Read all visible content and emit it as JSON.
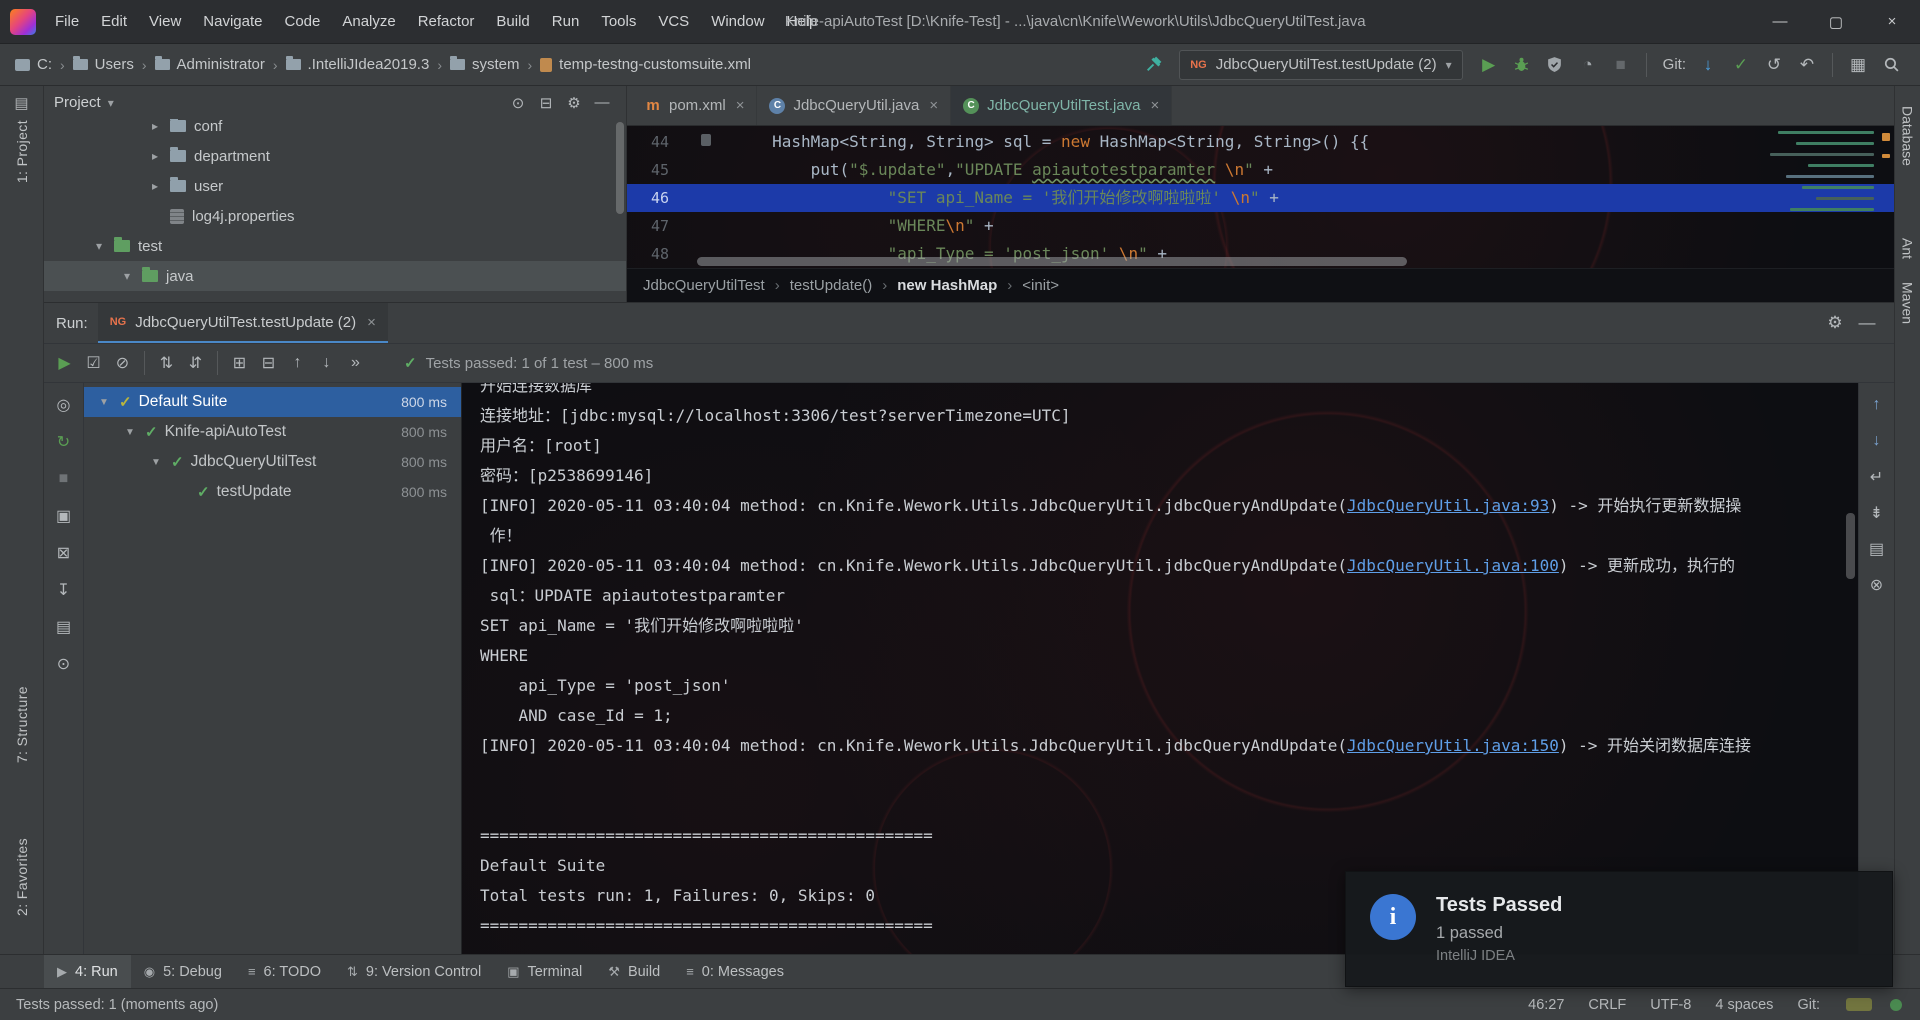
{
  "glyphs": {
    "crumb_sep": "›",
    "expanded": "▾",
    "collapsed": "▸",
    "tree_expanded": "▼",
    "close": "×",
    "check": "✓",
    "caret": "▾"
  },
  "title_bar": {
    "menus": [
      "File",
      "Edit",
      "View",
      "Navigate",
      "Code",
      "Analyze",
      "Refactor",
      "Build",
      "Run",
      "Tools",
      "VCS",
      "Window",
      "Help"
    ],
    "title": "Knife-apiAutoTest [D:\\Knife-Test] - ...\\java\\cn\\Knife\\Wework\\Utils\\JdbcQueryUtilTest.java",
    "window_buttons": [
      {
        "name": "minimize-button",
        "glyph": "—"
      },
      {
        "name": "maximize-button",
        "glyph": "▢"
      },
      {
        "name": "close-button",
        "glyph": "×"
      }
    ]
  },
  "navbar": {
    "breadcrumbs": [
      {
        "label": "C:",
        "icon": "drive"
      },
      {
        "label": "Users",
        "icon": "folder"
      },
      {
        "label": "Administrator",
        "icon": "folder"
      },
      {
        "label": ".IntelliJIdea2019.3",
        "icon": "folder"
      },
      {
        "label": "system",
        "icon": "folder"
      },
      {
        "label": "temp-testng-customsuite.xml",
        "icon": "xml-file"
      }
    ],
    "run_config": {
      "label": "JdbcQueryUtilTest.testUpdate (2)",
      "icon_text": "NG"
    },
    "run_actions": [
      {
        "name": "run-button",
        "g": "▶",
        "color": "#5a9e53"
      },
      {
        "name": "debug-button",
        "svg": "bug",
        "color": "#5a9e53"
      },
      {
        "name": "coverage-button",
        "svg": "shield",
        "color": "#a0a6aa"
      },
      {
        "name": "profiler-button",
        "g": "◔",
        "color": "#a0a6aa"
      },
      {
        "name": "stop-button",
        "g": "■",
        "color": "#64686b"
      }
    ],
    "git_label": "Git:",
    "git_actions": [
      {
        "name": "git-update-button",
        "g": "↓",
        "color": "#4b9edd"
      },
      {
        "name": "git-commit-button",
        "g": "✓",
        "color": "#5a9e53"
      },
      {
        "name": "git-history-button",
        "g": "↺"
      },
      {
        "name": "git-rollback-button",
        "g": "↶"
      }
    ],
    "right_actions": [
      {
        "name": "toolwindow-layout-button",
        "g": "▦"
      },
      {
        "name": "search-everywhere-button",
        "svg": "search"
      }
    ]
  },
  "activity_bars": {
    "left_top": "1: Project",
    "left_middle": "7: Structure",
    "left_bottom": "2: Favorites",
    "right": [
      "Database",
      "Ant",
      "Maven"
    ]
  },
  "project": {
    "header": "Project",
    "caret": "▾",
    "header_icons": [
      {
        "name": "select-opened-file-icon",
        "g": "⊙"
      },
      {
        "name": "collapse-all-icon",
        "g": "⊟"
      },
      {
        "name": "project-options-icon",
        "g": "⚙"
      },
      {
        "name": "hide-project-panel-icon",
        "g": "—"
      }
    ],
    "items": [
      {
        "label": "conf",
        "icon": "folder",
        "indent": 4,
        "arrow": true,
        "expanded": false
      },
      {
        "label": "department",
        "icon": "folder",
        "indent": 4,
        "arrow": true,
        "expanded": false
      },
      {
        "label": "user",
        "icon": "folder",
        "indent": 4,
        "arrow": true,
        "expanded": false
      },
      {
        "label": "log4j.properties",
        "icon": "props",
        "indent": 4,
        "arrow": false
      },
      {
        "label": "test",
        "icon": "folder-test",
        "indent": 2,
        "arrow": true,
        "expanded": true
      },
      {
        "label": "java",
        "icon": "folder-source",
        "indent": 3,
        "arrow": true,
        "expanded": true,
        "selected": true
      }
    ]
  },
  "editor": {
    "tabs": [
      {
        "label": "pom.xml",
        "icon": "maven",
        "icon_text": "m",
        "active": false
      },
      {
        "label": "JdbcQueryUtil.java",
        "icon": "class",
        "icon_text": "C",
        "active": false
      },
      {
        "label": "JdbcQueryUtilTest.java",
        "icon": "test",
        "icon_text": "C",
        "active": true
      }
    ],
    "lines": [
      {
        "num": "44",
        "segs": [
          {
            "c": "p",
            "t": "        HashMap<String, String> sql = "
          },
          {
            "c": "kw",
            "t": "new "
          },
          {
            "c": "p",
            "t": "HashMap<String, String>() {{"
          }
        ]
      },
      {
        "num": "45",
        "segs": [
          {
            "c": "p",
            "t": "            put("
          },
          {
            "c": "str",
            "t": "\"$.update\""
          },
          {
            "c": "p",
            "t": ","
          },
          {
            "c": "str",
            "t": "\"UPDATE "
          },
          {
            "c": "stru",
            "t": "apiautotestparamter"
          },
          {
            "c": "str",
            "t": " "
          },
          {
            "c": "esc",
            "t": "\\n"
          },
          {
            "c": "str",
            "t": "\""
          },
          {
            "c": "p",
            "t": " +"
          }
        ]
      },
      {
        "num": "46",
        "hl": true,
        "segs": [
          {
            "c": "str",
            "t": "                    \"SET api_Name = '我们开始修改啊啦啦啦' "
          },
          {
            "c": "esc",
            "t": "\\n"
          },
          {
            "c": "str",
            "t": "\""
          },
          {
            "c": "p",
            "t": " +"
          }
        ]
      },
      {
        "num": "47",
        "segs": [
          {
            "c": "str",
            "t": "                    \"WHERE"
          },
          {
            "c": "esc",
            "t": "\\n"
          },
          {
            "c": "str",
            "t": "\""
          },
          {
            "c": "p",
            "t": " +"
          }
        ]
      },
      {
        "num": "48",
        "segs": [
          {
            "c": "str",
            "t": "                    \"api_Type = 'post_json' "
          },
          {
            "c": "esc",
            "t": "\\n"
          },
          {
            "c": "str",
            "t": "\""
          },
          {
            "c": "p",
            "t": " +"
          }
        ]
      }
    ],
    "breadcrumbs": [
      {
        "label": "JdbcQueryUtilTest"
      },
      {
        "label": "testUpdate()"
      },
      {
        "label": "new HashMap",
        "current": true
      },
      {
        "label": "<init>"
      }
    ]
  },
  "run": {
    "label": "Run:",
    "tab_label": "JdbcQueryUtilTest.testUpdate (2)",
    "tab_icon_text": "NG",
    "header_icons": [
      {
        "name": "run-settings-icon",
        "g": "⚙"
      },
      {
        "name": "hide-run-panel-icon",
        "g": "—"
      }
    ],
    "toolbar": [
      {
        "name": "rerun-tests-icon",
        "g": "▶",
        "color": "#5a9e53"
      },
      {
        "name": "rerun-failed-icon",
        "g": "☑"
      },
      {
        "name": "toggle-auto-test-icon",
        "g": "⊘"
      },
      {
        "sep": true
      },
      {
        "name": "sort-alphabetically-icon",
        "g": "⇅"
      },
      {
        "name": "sort-by-duration-icon",
        "g": "⇵"
      },
      {
        "sep": true
      },
      {
        "name": "expand-all-icon",
        "g": "⊞"
      },
      {
        "name": "collapse-all-icon",
        "g": "⊟"
      },
      {
        "name": "previous-failed-icon",
        "g": "↑"
      },
      {
        "name": "next-failed-icon",
        "g": "↓"
      },
      {
        "name": "more-actions-icon",
        "g": "»"
      }
    ],
    "status_icon": "✓",
    "status": "Tests passed: 1 of 1 test – 800 ms",
    "left_strip": [
      {
        "name": "filter-tests-icon",
        "g": "◎"
      },
      {
        "name": "rerun-failed-tests-icon",
        "g": "↻",
        "color": "#5a9e53"
      },
      {
        "name": "stop-process-icon",
        "g": "■",
        "color": "#6f7376"
      },
      {
        "name": "test-history-icon",
        "g": "▣"
      },
      {
        "name": "kill-process-icon",
        "g": "⊠"
      },
      {
        "name": "import-test-results-icon",
        "g": "↧"
      },
      {
        "name": "restore-layout-icon",
        "g": "▤"
      },
      {
        "name": "pin-tab-icon",
        "g": "⊙"
      }
    ],
    "tree": [
      {
        "label": "Default Suite",
        "time": "800 ms",
        "indent": 0,
        "arrow": true,
        "check": "suite",
        "selected": true
      },
      {
        "label": "Knife-apiAutoTest",
        "time": "800 ms",
        "indent": 1,
        "arrow": true,
        "check": "pass"
      },
      {
        "label": "JdbcQueryUtilTest",
        "time": "800 ms",
        "indent": 2,
        "arrow": true,
        "check": "pass"
      },
      {
        "label": "testUpdate",
        "time": "800 ms",
        "indent": 3,
        "arrow": false,
        "check": "pass"
      }
    ],
    "console": {
      "lines": [
        {
          "clip": true,
          "segs": [
            {
              "c": "p",
              "t": "开始连接数据库"
            }
          ]
        },
        {
          "segs": [
            {
              "c": "p",
              "t": "连接地址：[jdbc:mysql://localhost:3306/test?serverTimezone=UTC]"
            }
          ]
        },
        {
          "segs": [
            {
              "c": "p",
              "t": "用户名：[root]"
            }
          ]
        },
        {
          "segs": [
            {
              "c": "p",
              "t": "密码：[p2538699146]"
            }
          ]
        },
        {
          "segs": [
            {
              "c": "p",
              "t": "[INFO] 2020-05-11 03:40:04 method: cn.Knife.Wework.Utils.JdbcQueryUtil.jdbcQueryAndUpdate("
            },
            {
              "c": "lnk",
              "t": "JdbcQueryUtil.java:93"
            },
            {
              "c": "p",
              "t": ") -> 开始执行更新数据操"
            }
          ]
        },
        {
          "segs": [
            {
              "c": "p",
              "t": " 作！"
            }
          ]
        },
        {
          "segs": [
            {
              "c": "p",
              "t": "[INFO] 2020-05-11 03:40:04 method: cn.Knife.Wework.Utils.JdbcQueryUtil.jdbcQueryAndUpdate("
            },
            {
              "c": "lnk",
              "t": "JdbcQueryUtil.java:100"
            },
            {
              "c": "p",
              "t": ") -> 更新成功，执行的"
            }
          ]
        },
        {
          "segs": [
            {
              "c": "p",
              "t": " sql：UPDATE apiautotestparamter"
            }
          ]
        },
        {
          "segs": [
            {
              "c": "p",
              "t": "SET api_Name = '我们开始修改啊啦啦啦'"
            }
          ]
        },
        {
          "segs": [
            {
              "c": "p",
              "t": "WHERE"
            }
          ]
        },
        {
          "segs": [
            {
              "c": "p",
              "t": "    api_Type = 'post_json'"
            }
          ]
        },
        {
          "segs": [
            {
              "c": "p",
              "t": "    AND case_Id = 1;"
            }
          ]
        },
        {
          "segs": [
            {
              "c": "p",
              "t": "[INFO] 2020-05-11 03:40:04 method: cn.Knife.Wework.Utils.JdbcQueryUtil.jdbcQueryAndUpdate("
            },
            {
              "c": "lnk",
              "t": "JdbcQueryUtil.java:150"
            },
            {
              "c": "p",
              "t": ") -> 开始关闭数据库连接"
            }
          ]
        },
        {
          "segs": []
        },
        {
          "segs": []
        },
        {
          "segs": [
            {
              "c": "p",
              "t": "==============================================="
            }
          ]
        },
        {
          "segs": [
            {
              "c": "p",
              "t": "Default Suite"
            }
          ]
        },
        {
          "segs": [
            {
              "c": "p",
              "t": "Total tests run: 1, Failures: 0, Skips: 0"
            }
          ]
        },
        {
          "segs": [
            {
              "c": "p",
              "t": "==============================================="
            }
          ]
        }
      ]
    },
    "console_strip": [
      {
        "name": "up-stack-trace-icon",
        "g": "↑",
        "color": "#7ba3d0"
      },
      {
        "name": "down-stack-trace-icon",
        "g": "↓",
        "color": "#7ba3d0"
      },
      {
        "name": "soft-wrap-icon",
        "g": "↵"
      },
      {
        "name": "scroll-to-end-icon",
        "g": "⇟"
      },
      {
        "name": "print-icon",
        "g": "▤"
      },
      {
        "name": "clear-console-icon",
        "g": "⊗"
      }
    ]
  },
  "bottom_bar": {
    "items": [
      {
        "key": "run",
        "label": "4: Run",
        "glyph": "▶",
        "active": true
      },
      {
        "key": "debug",
        "label": "5: Debug",
        "glyph": "◉"
      },
      {
        "key": "todo",
        "label": "6: TODO",
        "glyph": "≡"
      },
      {
        "key": "vcs",
        "label": "9: Version Control",
        "glyph": "⇅"
      },
      {
        "key": "terminal",
        "label": "Terminal",
        "glyph": "▣"
      },
      {
        "key": "build",
        "label": "Build",
        "glyph": "⚒"
      },
      {
        "key": "messages",
        "label": "0: Messages",
        "glyph": "≡"
      }
    ]
  },
  "status_bar": {
    "left": "Tests passed: 1 (moments ago)",
    "right": [
      "46:27",
      "CRLF",
      "UTF-8",
      "4 spaces",
      "Git:"
    ]
  },
  "notification": {
    "icon_glyph": "i",
    "title": "Tests Passed",
    "body": "1 passed",
    "source": "IntelliJ IDEA"
  }
}
